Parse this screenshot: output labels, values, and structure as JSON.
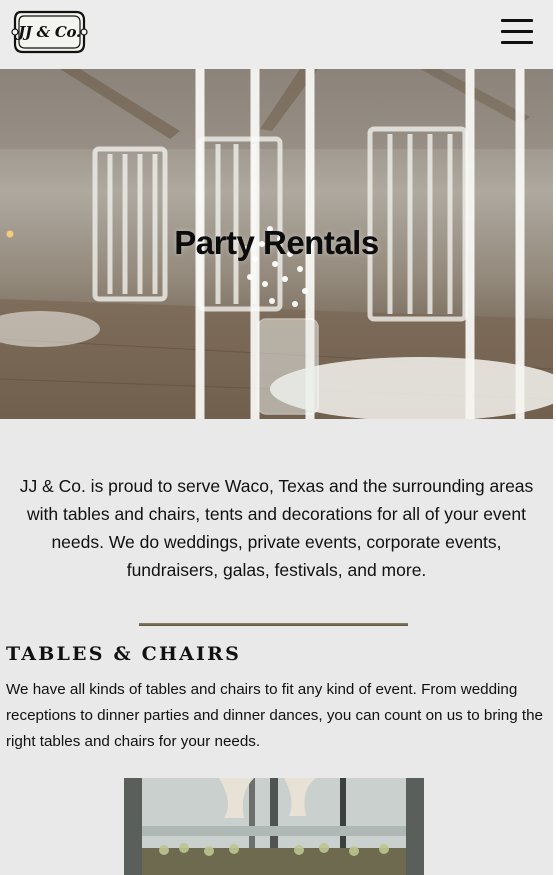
{
  "header": {
    "logo_text": "JJ & Co.",
    "menu_icon": "hamburger-menu-icon"
  },
  "hero": {
    "title": "Party Rentals"
  },
  "intro": {
    "text": "JJ & Co. is proud to serve Waco, Texas and the surrounding areas with tables and chairs, tents and decorations for all of your event needs. We do weddings, private events, corporate events, fundraisers, galas, festivals, and more."
  },
  "tables_chairs": {
    "heading": "TABLES & CHAIRS",
    "body": "We have all kinds of tables and chairs to fit any kind of event. From wedding receptions to dinner parties and dinner dances, you can count on us to bring the right tables and chairs for your needs."
  },
  "colors": {
    "background": "#e9e9e9",
    "divider": "#7a7053",
    "text": "#111111"
  }
}
